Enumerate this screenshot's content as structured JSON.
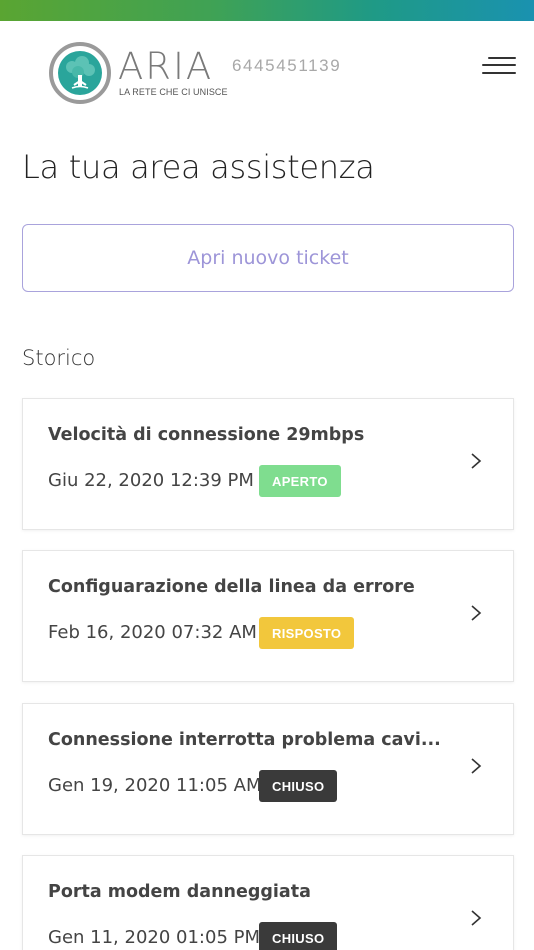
{
  "brand": {
    "name": "ARIA",
    "tagline": "LA RETE CHE CI UNISCE",
    "top_bar_colors": [
      "#5aa532",
      "#1a92b0"
    ],
    "logo_color": "#2aa59b"
  },
  "header": {
    "phone": "6445451139",
    "menu_icon": "hamburger-menu-icon"
  },
  "page": {
    "title": "La tua area assistenza",
    "new_ticket_label": "Apri nuovo ticket",
    "history_title": "Storico"
  },
  "tickets": [
    {
      "title": "Velocità di connessione 29mbps",
      "date": "Giu 22, 2020 12:39 PM",
      "status": "APERTO",
      "status_color": "#7fdd8f"
    },
    {
      "title": "Configuarazione della linea da errore",
      "date": "Feb 16, 2020 07:32 AM",
      "status": "RISPOSTO",
      "status_color": "#f2c73c"
    },
    {
      "title": "Connessione interrotta problema cavi...",
      "date": "Gen 19, 2020 11:05 AM",
      "status": "CHIUSO",
      "status_color": "#3a3a3a"
    },
    {
      "title": "Porta modem danneggiata",
      "date": "Gen 11, 2020 01:05 PM",
      "status": "CHIUSO",
      "status_color": "#3a3a3a"
    }
  ]
}
